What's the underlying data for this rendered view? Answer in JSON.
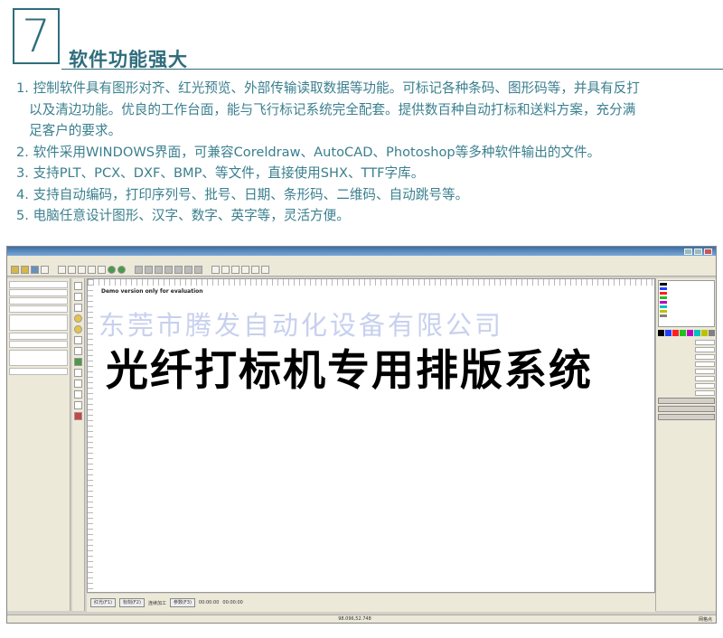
{
  "section": {
    "number": "7",
    "heading": "软件功能强大"
  },
  "features": [
    "1. 控制软件具有图形对齐、红光预览、外部传输读取数据等功能。可标记各种条码、图形码等，并具有反打",
    "以及清边功能。优良的工作台面，能与飞行标记系统完全配套。提供数百种自动打标和送料方案，充分满",
    "足客户的要求。",
    "2. 软件采用WINDOWS界面，可兼容Coreldraw、AutoCAD、Photoshop等多种软件输出的文件。",
    "3. 支持PLT、PCX、DXF、BMP、等文件，直接使用SHX、TTF字库。",
    "4. 支持自动编码，打印序列号、批号、日期、条形码、二维码、自动跳号等。",
    "5. 电脑任意设计图形、汉字、数字、英字等，灵活方便。"
  ],
  "software": {
    "demo_notice": "Demo version only for evaluation",
    "watermark": "东莞市腾发自动化设备有限公司",
    "canvas_text": "光纤打标机专用排版系统",
    "bottom": {
      "red_light": "红光(F1)",
      "mark": "标刻(F2)",
      "continuous": "连续加工",
      "param": "参数(F3)",
      "time1": "00:00:00",
      "time2": "00:00:00"
    },
    "status_coords": "98.096,52.748",
    "status_right": "网格点"
  },
  "colors": {
    "accent": "#2f6d7c",
    "text": "#3a7f8e",
    "pens": [
      "#000000",
      "#2040ff",
      "#ff2020",
      "#20c020",
      "#c000c0",
      "#00c0c0",
      "#c0c000",
      "#808080"
    ]
  }
}
